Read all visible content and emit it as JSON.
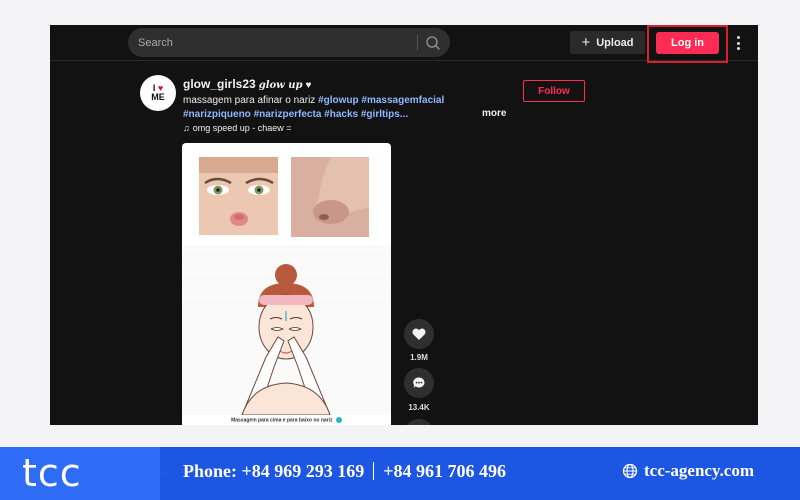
{
  "topbar": {
    "search_placeholder": "Search",
    "upload_label": "Upload",
    "login_label": "Log in"
  },
  "post": {
    "avatar_line1": "I",
    "avatar_line2": "ME",
    "username": "glow_girls23",
    "nickname": "glow up",
    "nick_heart": "♥",
    "caption_text": "massagem para afinar o nariz ",
    "hashtags": [
      "#glowup",
      "#massagemfacial",
      "#narizpiqueno",
      "#narizperfecta",
      "#hacks",
      "#girltips..."
    ],
    "more_label": "more",
    "music": "omg speed up - chaew =",
    "follow_label": "Follow",
    "video_caption": "Massagem para cima e para baixo no nariz"
  },
  "actions": {
    "likes": "1.9M",
    "comments": "13.4K"
  },
  "footer": {
    "logo": "tcc",
    "phone_1": "Phone: +84 969 293 169",
    "phone_2": "+84 961 706 496",
    "website": "tcc-agency.com"
  },
  "colors": {
    "accent": "#fe2c55",
    "highlight": "#d81f2c",
    "hashtag": "#8fb8ff",
    "footer_blue": "#1d56e3"
  }
}
